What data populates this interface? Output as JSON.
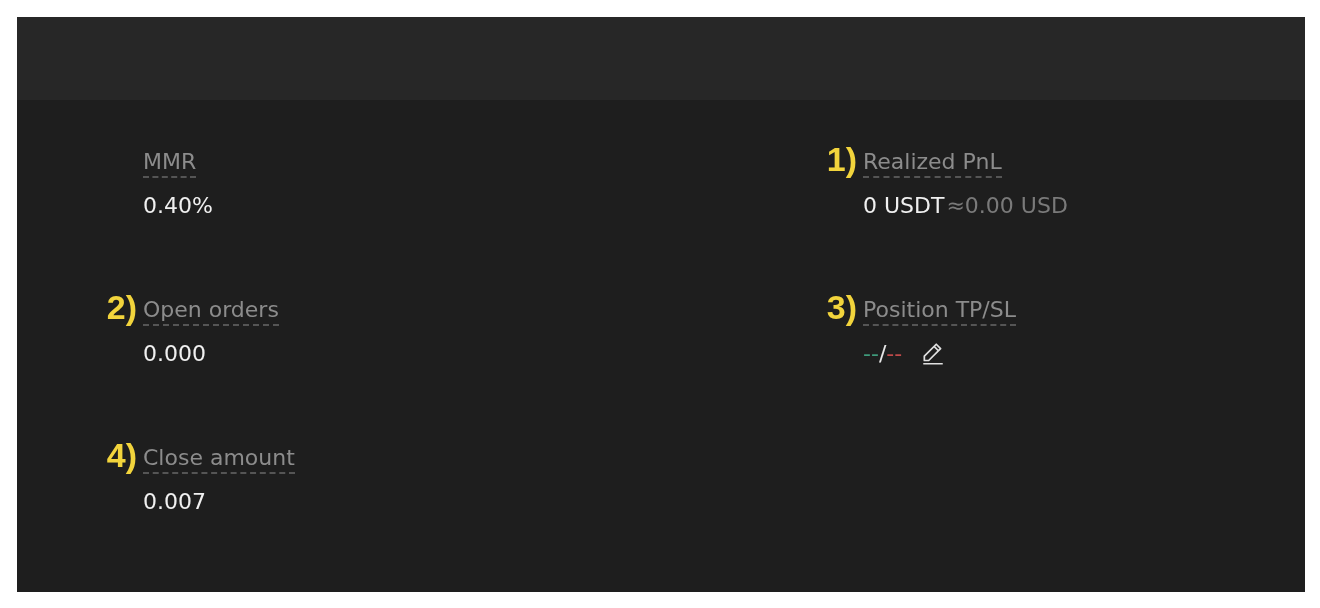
{
  "rows": [
    [
      {
        "label": "MMR",
        "kind": "text",
        "value": "0.40%"
      },
      {
        "marker": "1)",
        "label": "Realized PnL",
        "kind": "amount",
        "value": "0 USDT",
        "approx": "≈0.00 USD"
      }
    ],
    [
      {
        "marker": "2)",
        "label": "Open orders",
        "kind": "text",
        "value": "0.000"
      },
      {
        "marker": "3)",
        "label": "Position TP/SL",
        "kind": "tpsl",
        "parts": [
          {
            "text": "--",
            "color": "#3f9c7c"
          },
          {
            "text": "/",
            "color": "#e8e8e8"
          },
          {
            "text": "--",
            "color": "#c04a4a"
          }
        ]
      }
    ],
    [
      {
        "marker": "4)",
        "label": "Close amount",
        "kind": "text",
        "value": "0.007"
      }
    ]
  ]
}
